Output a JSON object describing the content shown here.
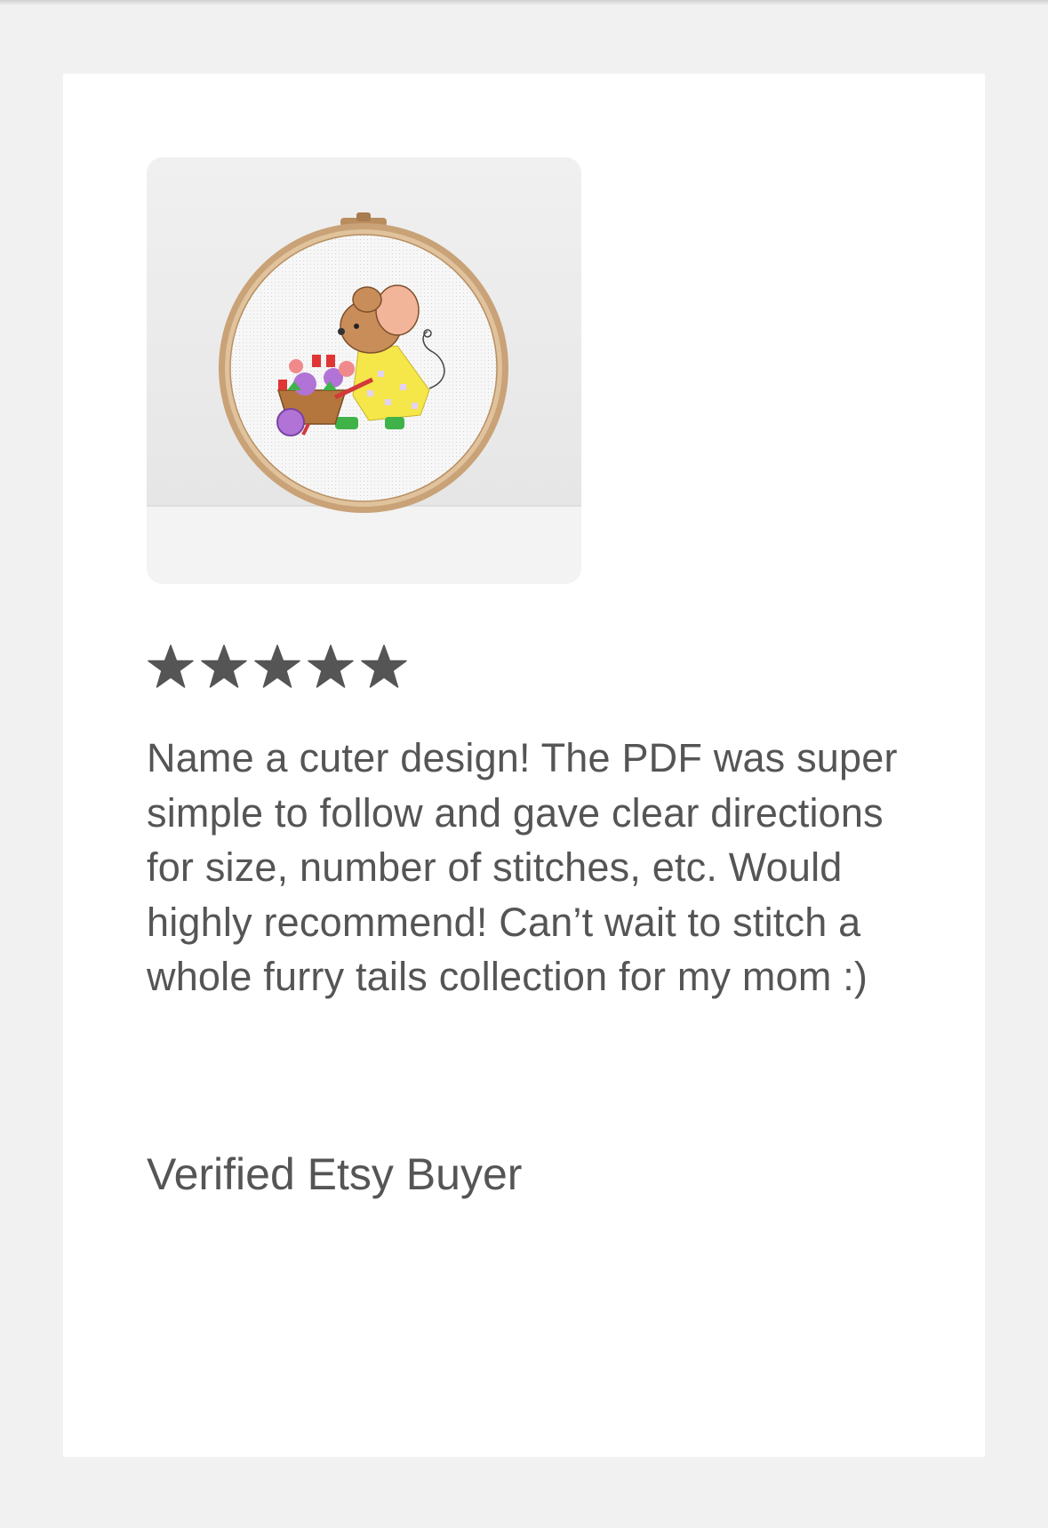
{
  "review": {
    "photo_alt": "Cross stitch of a mouse pushing a wheelbarrow of flowers in an embroidery hoop",
    "rating": 5,
    "rating_max": 5,
    "star_color": "#555555",
    "text": "Name a cuter design! The PDF was super simple to follow and gave clear directions for size, number of stitches, etc. Would highly recommend! Can’t wait to stitch a whole furry tails collection for my mom :)",
    "reviewer": "Verified Etsy Buyer"
  }
}
